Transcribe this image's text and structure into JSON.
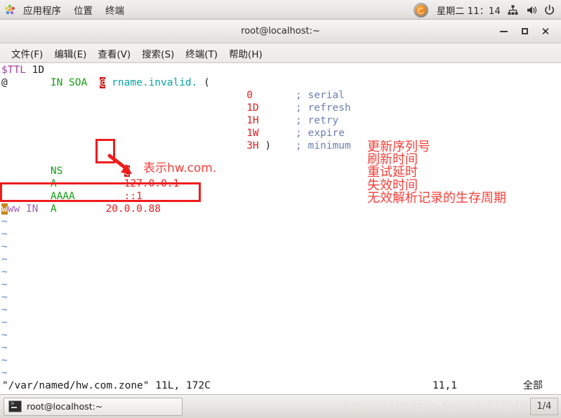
{
  "top_panel": {
    "apps_icon": "applications-icon",
    "menus": [
      "应用程序",
      "位置",
      "终端"
    ],
    "status_icon": "pumpkin-circle-icon",
    "clock": "星期二 11：14",
    "tray_icons": [
      "network-icon",
      "volume-icon",
      "power-icon"
    ]
  },
  "window": {
    "title": "root@localhost:~",
    "buttons": {
      "minimize": "minimize-icon",
      "maximize": "maximize-icon",
      "close": "close-icon"
    },
    "menubar": [
      "文件(F)",
      "编辑(E)",
      "查看(V)",
      "搜索(S)",
      "终端(T)",
      "帮助(H)"
    ]
  },
  "editor": {
    "lines": [
      {
        "id": "line-1",
        "segments": [
          {
            "text": "$TTL",
            "color": "magenta"
          },
          {
            "text": " ",
            "color": "dark"
          },
          {
            "text": "1D",
            "color": "dark"
          }
        ]
      },
      {
        "id": "line-2",
        "segments": [
          {
            "text": "@",
            "color": "dark"
          },
          {
            "text": "       ",
            "color": "dark"
          },
          {
            "text": "IN SOA",
            "color": "green"
          },
          {
            "text": "  ",
            "color": "dark"
          },
          {
            "text": "@",
            "color": "at-highlight"
          },
          {
            "text": " ",
            "color": "dark"
          },
          {
            "text": "rname.invalid.",
            "color": "teal"
          },
          {
            "text": " (",
            "color": "dark"
          }
        ]
      },
      {
        "id": "line-3",
        "segments": [
          {
            "text": "                                        ",
            "color": "dark"
          },
          {
            "text": "0",
            "color": "red"
          },
          {
            "text": "       ; serial",
            "color": "slate"
          }
        ]
      },
      {
        "id": "line-4",
        "segments": [
          {
            "text": "                                        ",
            "color": "dark"
          },
          {
            "text": "1D",
            "color": "red"
          },
          {
            "text": "      ; refresh",
            "color": "slate"
          }
        ]
      },
      {
        "id": "line-5",
        "segments": [
          {
            "text": "                                        ",
            "color": "dark"
          },
          {
            "text": "1H",
            "color": "red"
          },
          {
            "text": "      ; retry",
            "color": "slate"
          }
        ]
      },
      {
        "id": "line-6",
        "segments": [
          {
            "text": "                                        ",
            "color": "dark"
          },
          {
            "text": "1W",
            "color": "red"
          },
          {
            "text": "      ; expire",
            "color": "slate"
          }
        ]
      },
      {
        "id": "line-7",
        "segments": [
          {
            "text": "                                        ",
            "color": "dark"
          },
          {
            "text": "3H",
            "color": "red"
          },
          {
            "text": " )",
            "color": "dark"
          },
          {
            "text": "    ; minimum",
            "color": "slate"
          }
        ]
      },
      {
        "id": "line-8",
        "segments": [
          {
            "text": "",
            "color": "dark"
          }
        ]
      },
      {
        "id": "line-9",
        "segments": [
          {
            "text": "        ",
            "color": "dark"
          },
          {
            "text": "NS",
            "color": "green"
          },
          {
            "text": "          ",
            "color": "dark"
          },
          {
            "text": "@",
            "color": "at-highlight"
          }
        ]
      },
      {
        "id": "line-10",
        "segments": [
          {
            "text": "        ",
            "color": "dark"
          },
          {
            "text": "A",
            "color": "green"
          },
          {
            "text": "           ",
            "color": "dark"
          },
          {
            "text": "127.0.0.1",
            "color": "red"
          }
        ]
      },
      {
        "id": "line-11",
        "segments": [
          {
            "text": "        ",
            "color": "dark"
          },
          {
            "text": "AAAA",
            "color": "green"
          },
          {
            "text": "        ",
            "color": "dark"
          },
          {
            "text": "::1",
            "color": "red"
          }
        ]
      },
      {
        "id": "line-12",
        "segments": [
          {
            "text": "w",
            "color": "cursor"
          },
          {
            "text": "ww",
            "color": "purple"
          },
          {
            "text": " ",
            "color": "dark"
          },
          {
            "text": "IN",
            "color": "purple"
          },
          {
            "text": "  ",
            "color": "dark"
          },
          {
            "text": "A",
            "color": "green"
          },
          {
            "text": "        ",
            "color": "dark"
          },
          {
            "text": "20.0.0.88",
            "color": "red"
          }
        ]
      }
    ],
    "empty_marker": "~",
    "empty_marker_count": 14,
    "statusline": {
      "file": "\"/var/named/hw.com.zone\" 11L, 172C",
      "position": "11,1",
      "scroll": "全部"
    }
  },
  "annotations": {
    "at_box_label": "表示hw.com.",
    "soa_labels": [
      "更新序列号",
      "刷新时间",
      "重试延时",
      "失效时间",
      "无效解析记录的生存周期"
    ],
    "box_color": "#ef1c1c",
    "text_color": "#f4403a"
  },
  "taskbar": {
    "window_button_label": "root@localhost:~",
    "window_button_icon": "terminal-icon",
    "watermark": "https://blog.csdn.net/m0_47219942",
    "workspace": "1/4"
  }
}
